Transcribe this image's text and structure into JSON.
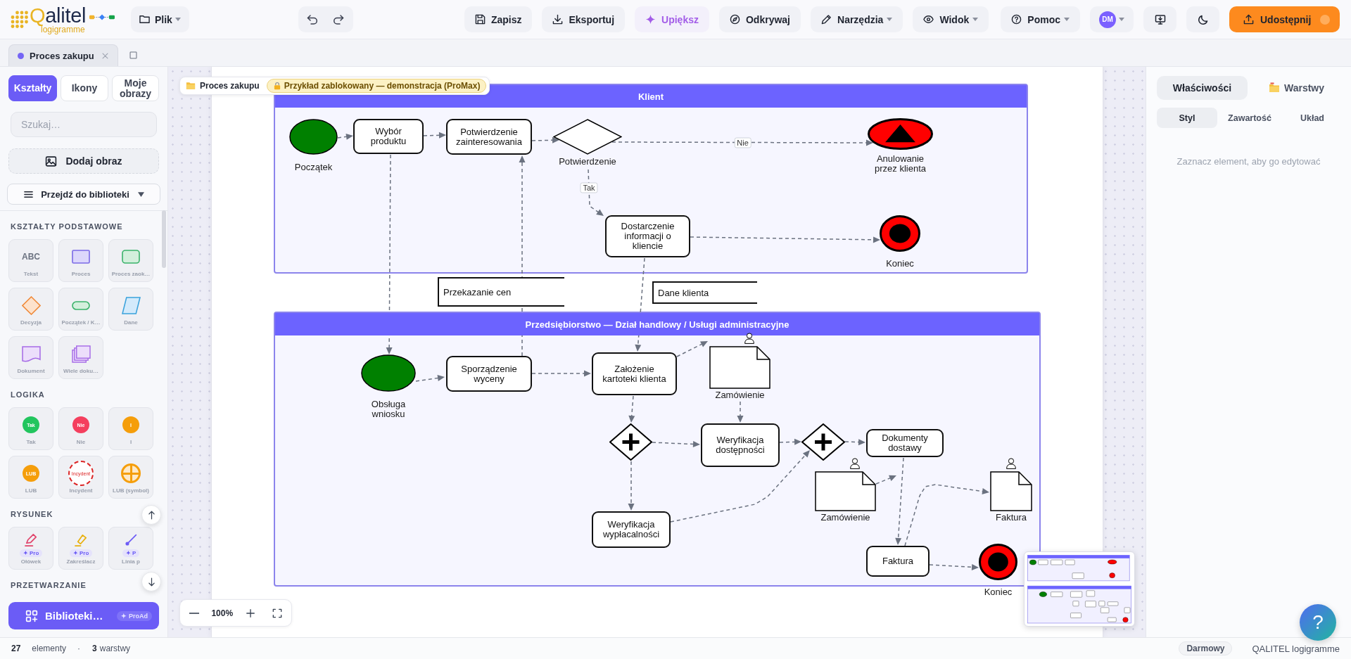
{
  "header": {
    "logo": {
      "name": "Qalitel",
      "tagline": "logigramme"
    },
    "file_menu": {
      "label": "Plik",
      "has_menu": true
    },
    "actions": [
      {
        "label": "Zapisz",
        "kind": "plain",
        "has_menu": false
      },
      {
        "label": "Eksportuj",
        "kind": "plain",
        "has_menu": false
      },
      {
        "label": "Upiększ",
        "kind": "accent",
        "has_menu": false
      },
      {
        "label": "Odkrywaj",
        "kind": "plain",
        "has_menu": false
      },
      {
        "label": "Narzędzia",
        "kind": "plain",
        "has_menu": true
      },
      {
        "label": "Widok",
        "kind": "plain",
        "has_menu": true
      }
    ],
    "help_menu": {
      "label": "Pomoc",
      "has_menu": true
    },
    "user": {
      "initials": "DM",
      "has_menu": true
    },
    "share_button": {
      "label": "Udostępnij"
    }
  },
  "document_tabs": [
    {
      "label": "Proces zakupu",
      "selected": true
    }
  ],
  "sidebar": {
    "tabs": [
      {
        "label": "Kształty",
        "selected": true
      },
      {
        "label": "Ikony",
        "selected": false
      },
      {
        "label": "Moje obrazy",
        "selected": false
      }
    ],
    "search": {
      "placeholder": "Szukaj…"
    },
    "add_image_button": {
      "label": "Dodaj obraz"
    },
    "library_dropdown": {
      "label": "Przejdź do biblioteki"
    },
    "sections": [
      {
        "title": "KSZTAŁTY PODSTAWOWE",
        "items": [
          {
            "label": "Tekst",
            "kind": "text",
            "glyph": "ABC"
          },
          {
            "label": "Proces",
            "kind": "rectangle"
          },
          {
            "label": "Proces zaok…",
            "kind": "rounded-rectangle"
          },
          {
            "label": "Decyzja",
            "kind": "diamond"
          },
          {
            "label": "Początek / K…",
            "kind": "pill"
          },
          {
            "label": "Dane",
            "kind": "parallelogram"
          },
          {
            "label": "Dokument",
            "kind": "document"
          },
          {
            "label": "Wiele doku…",
            "kind": "multi-document"
          }
        ]
      },
      {
        "title": "LOGIKA",
        "items": [
          {
            "label": "Tak",
            "kind": "circle",
            "glyph": "Tak",
            "color": "#22c55e"
          },
          {
            "label": "Nie",
            "kind": "circle",
            "glyph": "Nie",
            "color": "#f43f5e"
          },
          {
            "label": "I",
            "kind": "circle",
            "glyph": "I",
            "color": "#f59e0b"
          },
          {
            "label": "LUB",
            "kind": "circle",
            "glyph": "LUB",
            "color": "#f59e0b"
          },
          {
            "label": "Incydent",
            "kind": "dashed-circle",
            "glyph": "Incydent",
            "color": "#dc2626"
          },
          {
            "label": "LUB (symbol)",
            "kind": "or-symbol",
            "color": "#f59e0b"
          }
        ]
      },
      {
        "title": "RYSUNEK",
        "items": [
          {
            "label": "Ołówek",
            "kind": "pencil",
            "badge": "✦ Pro"
          },
          {
            "label": "Zakreślacz",
            "kind": "highlighter",
            "badge": "✦ Pro"
          },
          {
            "label": "Linia p",
            "kind": "line",
            "badge": "✦ P"
          }
        ]
      },
      {
        "title": "PRZETWARZANIE"
      }
    ],
    "library_button": {
      "label": "Biblioteki…",
      "badge": "✦ ProAd"
    }
  },
  "canvas": {
    "breadcrumb": {
      "title": "Proces zakupu",
      "lock_notice": "Przykład zablokowany — demonstracja (ProMax)"
    },
    "pools": [
      {
        "title": "Klient",
        "nodes": [
          {
            "kind": "start",
            "label": "Początek"
          },
          {
            "kind": "task",
            "label": "Wybór\nproduktu"
          },
          {
            "kind": "task",
            "label": "Potwierdzenie\nzainteresowania"
          },
          {
            "kind": "gateway",
            "label": "Potwierdzenie"
          },
          {
            "kind": "cancel-end",
            "label": "Anulowanie\nprzez klienta"
          },
          {
            "kind": "task",
            "label": "Dostarczenie\ninformacji o\nkliencie"
          },
          {
            "kind": "end",
            "label": "Koniec"
          }
        ]
      },
      {
        "title": "Przedsiębiorstwo — Dział handlowy / Usługi administracyjne",
        "nodes": [
          {
            "kind": "start",
            "label": "Obsługa\nwniosku"
          },
          {
            "kind": "task",
            "label": "Sporządzenie\nwyceny"
          },
          {
            "kind": "task",
            "label": "Założenie\nkartoteki klienta"
          },
          {
            "kind": "document",
            "label": "Zamówienie"
          },
          {
            "kind": "parallel-gateway"
          },
          {
            "kind": "task",
            "label": "Weryfikacja\ndostępności"
          },
          {
            "kind": "parallel-gateway"
          },
          {
            "kind": "task",
            "label": "Dokumenty\ndostawy"
          },
          {
            "kind": "document",
            "label": "Zamówienie"
          },
          {
            "kind": "task",
            "label": "Weryfikacja\nwypłacalności"
          },
          {
            "kind": "document",
            "label": "Faktura"
          },
          {
            "kind": "task",
            "label": "Faktura"
          },
          {
            "kind": "end",
            "label": "Koniec"
          }
        ]
      }
    ],
    "annotations": [
      {
        "text": "Przekazanie cen"
      },
      {
        "text": "Dane klienta"
      }
    ],
    "connectors": [
      {
        "arrow": true
      },
      {
        "arrow": true
      },
      {
        "arrow": true
      },
      {
        "arrow": true,
        "label": "Nie"
      },
      {
        "arrow": true,
        "label": "Tak"
      },
      {
        "arrow": true
      },
      {
        "arrow": true
      },
      {
        "arrow": true
      },
      {
        "arrow": true
      },
      {
        "arrow": true
      },
      {
        "arrow": true
      },
      {
        "arrow": true
      },
      {
        "arrow": true
      },
      {
        "arrow": true
      },
      {
        "arrow": true
      },
      {
        "arrow": true
      },
      {
        "arrow": true
      },
      {
        "arrow": true
      },
      {
        "arrow": true
      },
      {
        "arrow": true
      },
      {
        "arrow": true
      },
      {
        "arrow": true
      },
      {
        "arrow": true
      }
    ],
    "zoom": {
      "level_text": "100%"
    }
  },
  "properties_panel": {
    "tabs": [
      {
        "label": "Właściwości",
        "selected": true
      },
      {
        "label": "Warstwy",
        "selected": false
      }
    ],
    "subtabs": [
      {
        "label": "Styl",
        "selected": true
      },
      {
        "label": "Zawartość",
        "selected": false
      },
      {
        "label": "Układ",
        "selected": false
      }
    ],
    "empty_message": "Zaznacz element, aby go edytować"
  },
  "status_bar": {
    "element_count": "27",
    "element_label": "elementy",
    "separator": "·",
    "layer_count": "3",
    "layer_label": "warstwy",
    "plan": "Darmowy",
    "brand": "QALITEL logigramme"
  },
  "help_button": {
    "label": "?"
  }
}
